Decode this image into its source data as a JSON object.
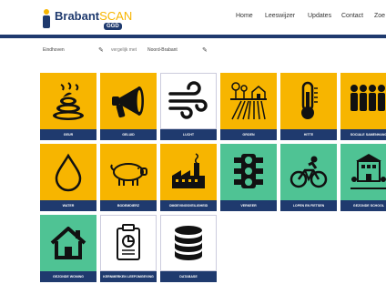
{
  "header": {
    "logo_brand": "Brabant",
    "logo_scan": "SCAN",
    "logo_badge": "GGD"
  },
  "nav": [
    "Home",
    "Leeswijzer",
    "Updates",
    "Contact",
    "Zoe"
  ],
  "location": {
    "place": "Eindhoven",
    "compare": "vergelijk met",
    "region": "Noord-Brabant"
  },
  "colors": {
    "yellow": "#f7b500",
    "green": "#4fc394",
    "navy": "#1f3a6e"
  },
  "tiles": [
    {
      "label": "GEUR",
      "icon": "poop-icon",
      "color": "yellow"
    },
    {
      "label": "GELUID",
      "icon": "megaphone-icon",
      "color": "yellow"
    },
    {
      "label": "LUCHT",
      "icon": "wind-icon",
      "color": "white"
    },
    {
      "label": "GROEN",
      "icon": "farm-icon",
      "color": "yellow"
    },
    {
      "label": "HITTE",
      "icon": "thermometer-icon",
      "color": "yellow"
    },
    {
      "label": "SOCIALE SAMENHANG",
      "icon": "people-icon",
      "color": "yellow"
    },
    {
      "label": "WATER",
      "icon": "water-drop-icon",
      "color": "yellow"
    },
    {
      "label": "BODEMDIERZ",
      "icon": "pig-icon",
      "color": "yellow"
    },
    {
      "label": "OMGEVINGSVEILIGHEID",
      "icon": "factory-icon",
      "color": "yellow"
    },
    {
      "label": "VERKEER",
      "icon": "traffic-light-icon",
      "color": "green"
    },
    {
      "label": "LOPEN EN FIETSEN",
      "icon": "cyclist-icon",
      "color": "green"
    },
    {
      "label": "GEZONDE SCHOOL",
      "icon": "school-icon",
      "color": "green"
    },
    {
      "label": "GEZONDE WONING",
      "icon": "house-icon",
      "color": "green"
    },
    {
      "label": "KERNMERKEN LEEFOMGEVING",
      "icon": "report-icon",
      "color": "white"
    },
    {
      "label": "DATABASE",
      "icon": "database-icon",
      "color": "white"
    }
  ]
}
